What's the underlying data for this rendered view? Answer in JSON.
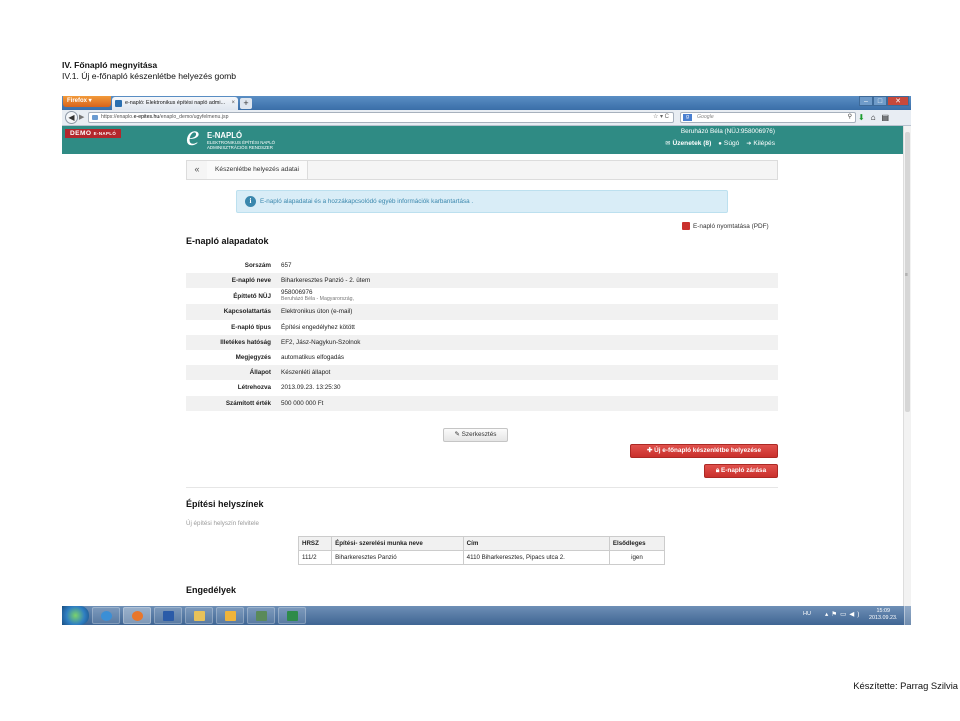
{
  "doc": {
    "heading1": "IV. Főnapló megnyitása",
    "heading2": "IV.1. Új e-főnapló készenlétbe helyezés gomb",
    "footer": "Készítette: Parrag Szilvia"
  },
  "browser": {
    "menu_button": "Firefox",
    "tab_title": "e-napló: Elektronikus építési napló admi...",
    "url_prefix": "https://enaplo.",
    "url_host": "e-epites.hu",
    "url_path": "/enaplo_demo/ugyfelmenu.jsp",
    "search_placeholder": "Google"
  },
  "app": {
    "demo_badge": "DEMO",
    "demo_badge_small": "E-NAPLÓ",
    "logo_letter": "e",
    "logo_title": "E-NAPLÓ",
    "logo_subtitle_1": "ELEKTRONIKUS ÉPÍTÉSI NAPLÓ",
    "logo_subtitle_2": "ADMINISZTRÁCIÓS RENDSZER",
    "user": "Beruházó Béla (NÜJ:958006976)",
    "messages": "Üzenetek (8)",
    "help": "Súgó",
    "logout": "Kilépés"
  },
  "breadcrumb": {
    "back": "«",
    "current": "Készenlétbe helyezés adatai"
  },
  "info": "E-napló alapadatai és a hozzákapcsolódó egyéb információk karbantartása .",
  "pdf_link": "E-napló nyomtatása (PDF)",
  "section_basic": "E-napló alapadatok",
  "details": [
    {
      "label": "Sorszám",
      "value": "657"
    },
    {
      "label": "E-napló neve",
      "value": "Biharkeresztes Panzió - 2. ütem"
    },
    {
      "label": "Építtető NÜJ",
      "value": "958006976",
      "sub": "Beruházó Béla - Magyarország,"
    },
    {
      "label": "Kapcsolattartás",
      "value": "Elektronikus úton (e-mail)"
    },
    {
      "label": "E-napló típus",
      "value": "Építési engedélyhez kötött"
    },
    {
      "label": "Illetékes hatóság",
      "value": "EF2, Jász-Nagykun-Szolnok"
    },
    {
      "label": "Megjegyzés",
      "value": "automatikus elfogadás"
    },
    {
      "label": "Állapot",
      "value": "Készenléti állapot"
    },
    {
      "label": "Létrehozva",
      "value": "2013.09.23. 13:25:30"
    },
    {
      "label": "Számított érték",
      "value": "500 000 000 Ft"
    }
  ],
  "buttons": {
    "edit": "Szerkesztés",
    "make_ready": "Új e-főnapló készenlétbe helyezése",
    "close": "E-napló zárása"
  },
  "section_places": "Építési helyszínek",
  "add_place": "Új építési helyszín felvitele",
  "places_table": {
    "headers": [
      "HRSZ",
      "Építési- szerelési munka neve",
      "Cím",
      "Elsődleges"
    ],
    "rows": [
      [
        "111/2",
        "Biharkeresztes Panzió",
        "4110 Biharkeresztes, Pipacs utca 2.",
        "igen"
      ]
    ]
  },
  "section_permits": "Engedélyek",
  "taskbar": {
    "lang": "HU",
    "time": "15:09",
    "date": "2013.09.23."
  },
  "colors": {
    "header": "#2f8b84",
    "danger": "#c9302c",
    "info_bg": "#d9edf7",
    "info_text": "#3a87ad"
  }
}
